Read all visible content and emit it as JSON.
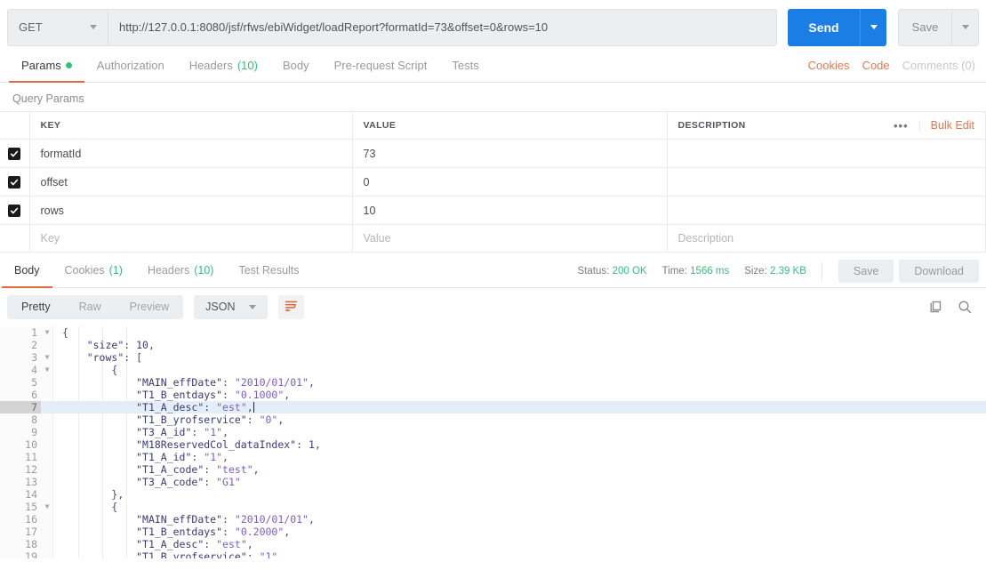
{
  "request": {
    "method": "GET",
    "url": "http://127.0.0.1:8080/jsf/rfws/ebiWidget/loadReport?formatId=73&offset=0&rows=10",
    "send_label": "Send",
    "save_label": "Save"
  },
  "request_tabs": [
    {
      "label": "Params",
      "badge": "",
      "dot": true,
      "active": true
    },
    {
      "label": "Authorization",
      "badge": "",
      "dot": false,
      "active": false
    },
    {
      "label": "Headers",
      "badge": "(10)",
      "dot": false,
      "active": false
    },
    {
      "label": "Body",
      "badge": "",
      "dot": false,
      "active": false
    },
    {
      "label": "Pre-request Script",
      "badge": "",
      "dot": false,
      "active": false
    },
    {
      "label": "Tests",
      "badge": "",
      "dot": false,
      "active": false
    }
  ],
  "request_tabs_right": {
    "cookies": "Cookies",
    "code": "Code",
    "comments": "Comments (0)"
  },
  "query_params": {
    "section_title": "Query Params",
    "columns": [
      "KEY",
      "VALUE",
      "DESCRIPTION"
    ],
    "bulk_edit": "Bulk Edit",
    "more_menu": "•••",
    "rows": [
      {
        "checked": true,
        "key": "formatId",
        "value": "73",
        "description": ""
      },
      {
        "checked": true,
        "key": "offset",
        "value": "0",
        "description": ""
      },
      {
        "checked": true,
        "key": "rows",
        "value": "10",
        "description": ""
      }
    ],
    "placeholder_row": {
      "key": "Key",
      "value": "Value",
      "description": "Description"
    }
  },
  "response": {
    "tabs": [
      {
        "label": "Body",
        "badge": "",
        "active": true
      },
      {
        "label": "Cookies",
        "badge": "(1)",
        "active": false
      },
      {
        "label": "Headers",
        "badge": "(10)",
        "active": false
      },
      {
        "label": "Test Results",
        "badge": "",
        "active": false
      }
    ],
    "status_label": "Status:",
    "status_value": "200 OK",
    "time_label": "Time:",
    "time_value": "1566 ms",
    "size_label": "Size:",
    "size_value": "2.39 KB",
    "save_label": "Save",
    "download_label": "Download"
  },
  "body_toolbar": {
    "views": [
      "Pretty",
      "Raw",
      "Preview"
    ],
    "active_view": "Pretty",
    "format": "JSON",
    "wrap_icon": "word-wrap-icon",
    "copy_icon": "copy-icon",
    "search_icon": "search-icon"
  },
  "code": {
    "highlight_line": 7,
    "folds": [
      1,
      3,
      4,
      15
    ],
    "lines": [
      {
        "n": 1,
        "indent": 0,
        "tokens": [
          {
            "t": "p",
            "v": "{"
          }
        ]
      },
      {
        "n": 2,
        "indent": 1,
        "tokens": [
          {
            "t": "k",
            "v": "\"size\""
          },
          {
            "t": "p",
            "v": ": "
          },
          {
            "t": "n",
            "v": "10"
          },
          {
            "t": "p",
            "v": ","
          }
        ]
      },
      {
        "n": 3,
        "indent": 1,
        "tokens": [
          {
            "t": "k",
            "v": "\"rows\""
          },
          {
            "t": "p",
            "v": ": ["
          }
        ]
      },
      {
        "n": 4,
        "indent": 2,
        "tokens": [
          {
            "t": "p",
            "v": "{"
          }
        ]
      },
      {
        "n": 5,
        "indent": 3,
        "tokens": [
          {
            "t": "k",
            "v": "\"MAIN_effDate\""
          },
          {
            "t": "p",
            "v": ": "
          },
          {
            "t": "s",
            "v": "\"2010/01/01\""
          },
          {
            "t": "p",
            "v": ","
          }
        ]
      },
      {
        "n": 6,
        "indent": 3,
        "tokens": [
          {
            "t": "k",
            "v": "\"T1_B_entdays\""
          },
          {
            "t": "p",
            "v": ": "
          },
          {
            "t": "s",
            "v": "\"0.1000\""
          },
          {
            "t": "p",
            "v": ","
          }
        ]
      },
      {
        "n": 7,
        "indent": 3,
        "tokens": [
          {
            "t": "k",
            "v": "\"T1_A_desc\""
          },
          {
            "t": "p",
            "v": ": "
          },
          {
            "t": "s",
            "v": "\"est\""
          },
          {
            "t": "p",
            "v": ","
          }
        ]
      },
      {
        "n": 8,
        "indent": 3,
        "tokens": [
          {
            "t": "k",
            "v": "\"T1_B_yrofservice\""
          },
          {
            "t": "p",
            "v": ": "
          },
          {
            "t": "s",
            "v": "\"0\""
          },
          {
            "t": "p",
            "v": ","
          }
        ]
      },
      {
        "n": 9,
        "indent": 3,
        "tokens": [
          {
            "t": "k",
            "v": "\"T3_A_id\""
          },
          {
            "t": "p",
            "v": ": "
          },
          {
            "t": "s",
            "v": "\"1\""
          },
          {
            "t": "p",
            "v": ","
          }
        ]
      },
      {
        "n": 10,
        "indent": 3,
        "tokens": [
          {
            "t": "k",
            "v": "\"M18ReservedCol_dataIndex\""
          },
          {
            "t": "p",
            "v": ": "
          },
          {
            "t": "n",
            "v": "1"
          },
          {
            "t": "p",
            "v": ","
          }
        ]
      },
      {
        "n": 11,
        "indent": 3,
        "tokens": [
          {
            "t": "k",
            "v": "\"T1_A_id\""
          },
          {
            "t": "p",
            "v": ": "
          },
          {
            "t": "s",
            "v": "\"1\""
          },
          {
            "t": "p",
            "v": ","
          }
        ]
      },
      {
        "n": 12,
        "indent": 3,
        "tokens": [
          {
            "t": "k",
            "v": "\"T1_A_code\""
          },
          {
            "t": "p",
            "v": ": "
          },
          {
            "t": "s",
            "v": "\"test\""
          },
          {
            "t": "p",
            "v": ","
          }
        ]
      },
      {
        "n": 13,
        "indent": 3,
        "tokens": [
          {
            "t": "k",
            "v": "\"T3_A_code\""
          },
          {
            "t": "p",
            "v": ": "
          },
          {
            "t": "s",
            "v": "\"G1\""
          }
        ]
      },
      {
        "n": 14,
        "indent": 2,
        "tokens": [
          {
            "t": "p",
            "v": "},"
          }
        ]
      },
      {
        "n": 15,
        "indent": 2,
        "tokens": [
          {
            "t": "p",
            "v": "{"
          }
        ]
      },
      {
        "n": 16,
        "indent": 3,
        "tokens": [
          {
            "t": "k",
            "v": "\"MAIN_effDate\""
          },
          {
            "t": "p",
            "v": ": "
          },
          {
            "t": "s",
            "v": "\"2010/01/01\""
          },
          {
            "t": "p",
            "v": ","
          }
        ]
      },
      {
        "n": 17,
        "indent": 3,
        "tokens": [
          {
            "t": "k",
            "v": "\"T1_B_entdays\""
          },
          {
            "t": "p",
            "v": ": "
          },
          {
            "t": "s",
            "v": "\"0.2000\""
          },
          {
            "t": "p",
            "v": ","
          }
        ]
      },
      {
        "n": 18,
        "indent": 3,
        "tokens": [
          {
            "t": "k",
            "v": "\"T1_A_desc\""
          },
          {
            "t": "p",
            "v": ": "
          },
          {
            "t": "s",
            "v": "\"est\""
          },
          {
            "t": "p",
            "v": ","
          }
        ]
      },
      {
        "n": 19,
        "indent": 3,
        "tokens": [
          {
            "t": "k",
            "v": "\"T1_B_yrofservice\""
          },
          {
            "t": "p",
            "v": ": "
          },
          {
            "t": "s",
            "v": "\"1\""
          },
          {
            "t": "p",
            "v": ","
          }
        ]
      }
    ]
  }
}
